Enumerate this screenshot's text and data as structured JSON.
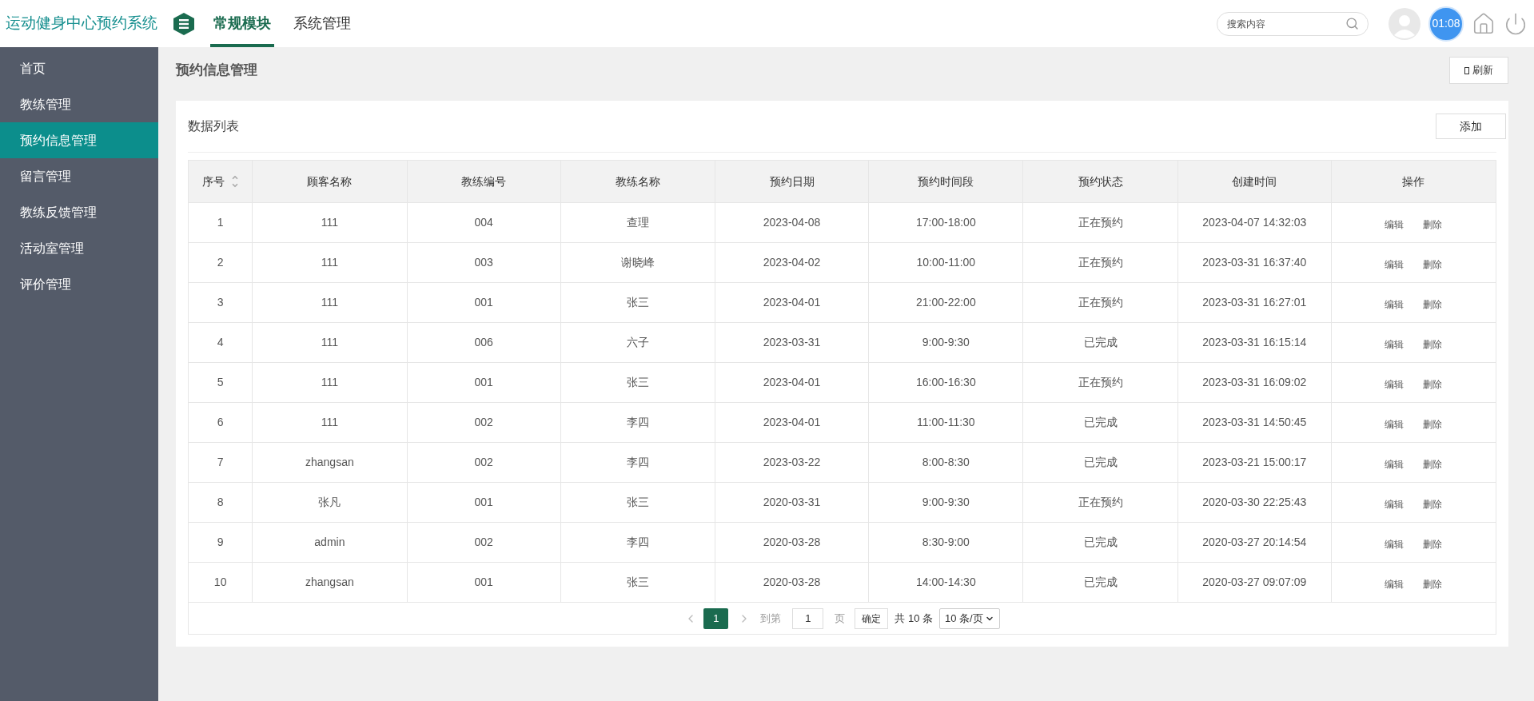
{
  "header": {
    "app_title": "运动健身中心预约系统",
    "nav_tabs": [
      {
        "label": "常规模块",
        "selected": true
      },
      {
        "label": "系统管理",
        "selected": false
      }
    ],
    "search": {
      "placeholder": "搜索内容"
    },
    "clock": "01:08"
  },
  "sidebar": {
    "items": [
      {
        "label": "首页",
        "selected": false
      },
      {
        "label": "教练管理",
        "selected": false
      },
      {
        "label": "预约信息管理",
        "selected": true
      },
      {
        "label": "留言管理",
        "selected": false
      },
      {
        "label": "教练反馈管理",
        "selected": false
      },
      {
        "label": "活动室管理",
        "selected": false
      },
      {
        "label": "评价管理",
        "selected": false
      }
    ]
  },
  "page": {
    "title": "预约信息管理",
    "refresh_button": "刷新"
  },
  "panel": {
    "title": "数据列表",
    "add_button": "添加"
  },
  "table": {
    "columns": [
      {
        "label": "序号",
        "sortable": true
      },
      {
        "label": "顾客名称",
        "sortable": false
      },
      {
        "label": "教练编号",
        "sortable": false
      },
      {
        "label": "教练名称",
        "sortable": false
      },
      {
        "label": "预约日期",
        "sortable": false
      },
      {
        "label": "预约时间段",
        "sortable": false
      },
      {
        "label": "预约状态",
        "sortable": false
      },
      {
        "label": "创建时间",
        "sortable": false
      },
      {
        "label": "操作",
        "sortable": false
      }
    ],
    "rows": [
      {
        "cells": [
          "1",
          "111",
          "004",
          "查理",
          "2023-04-08",
          "17:00-18:00",
          "正在预约",
          "2023-04-07 14:32:03"
        ],
        "actions": [
          "编辑",
          "删除"
        ]
      },
      {
        "cells": [
          "2",
          "111",
          "003",
          "谢晓峰",
          "2023-04-02",
          "10:00-11:00",
          "正在预约",
          "2023-03-31 16:37:40"
        ],
        "actions": [
          "编辑",
          "删除"
        ]
      },
      {
        "cells": [
          "3",
          "111",
          "001",
          "张三",
          "2023-04-01",
          "21:00-22:00",
          "正在预约",
          "2023-03-31 16:27:01"
        ],
        "actions": [
          "编辑",
          "删除"
        ]
      },
      {
        "cells": [
          "4",
          "111",
          "006",
          "六子",
          "2023-03-31",
          "9:00-9:30",
          "已完成",
          "2023-03-31 16:15:14"
        ],
        "actions": [
          "编辑",
          "删除"
        ]
      },
      {
        "cells": [
          "5",
          "111",
          "001",
          "张三",
          "2023-04-01",
          "16:00-16:30",
          "正在预约",
          "2023-03-31 16:09:02"
        ],
        "actions": [
          "编辑",
          "删除"
        ]
      },
      {
        "cells": [
          "6",
          "111",
          "002",
          "李四",
          "2023-04-01",
          "11:00-11:30",
          "已完成",
          "2023-03-31 14:50:45"
        ],
        "actions": [
          "编辑",
          "删除"
        ]
      },
      {
        "cells": [
          "7",
          "zhangsan",
          "002",
          "李四",
          "2023-03-22",
          "8:00-8:30",
          "已完成",
          "2023-03-21 15:00:17"
        ],
        "actions": [
          "编辑",
          "删除"
        ]
      },
      {
        "cells": [
          "8",
          "张凡",
          "001",
          "张三",
          "2020-03-31",
          "9:00-9:30",
          "正在预约",
          "2020-03-30 22:25:43"
        ],
        "actions": [
          "编辑",
          "删除"
        ]
      },
      {
        "cells": [
          "9",
          "admin",
          "002",
          "李四",
          "2020-03-28",
          "8:30-9:00",
          "已完成",
          "2020-03-27 20:14:54"
        ],
        "actions": [
          "编辑",
          "删除"
        ]
      },
      {
        "cells": [
          "10",
          "zhangsan",
          "001",
          "张三",
          "2020-03-28",
          "14:00-14:30",
          "已完成",
          "2020-03-27 09:07:09"
        ],
        "actions": [
          "编辑",
          "删除"
        ]
      }
    ]
  },
  "pagination": {
    "pages": [
      {
        "label": "1",
        "selected": true
      }
    ],
    "goto_label": "到第",
    "goto_value": "1",
    "page_unit": "页",
    "confirm_button": "确定",
    "total": "共 10 条",
    "page_size": "10 条/页"
  }
}
